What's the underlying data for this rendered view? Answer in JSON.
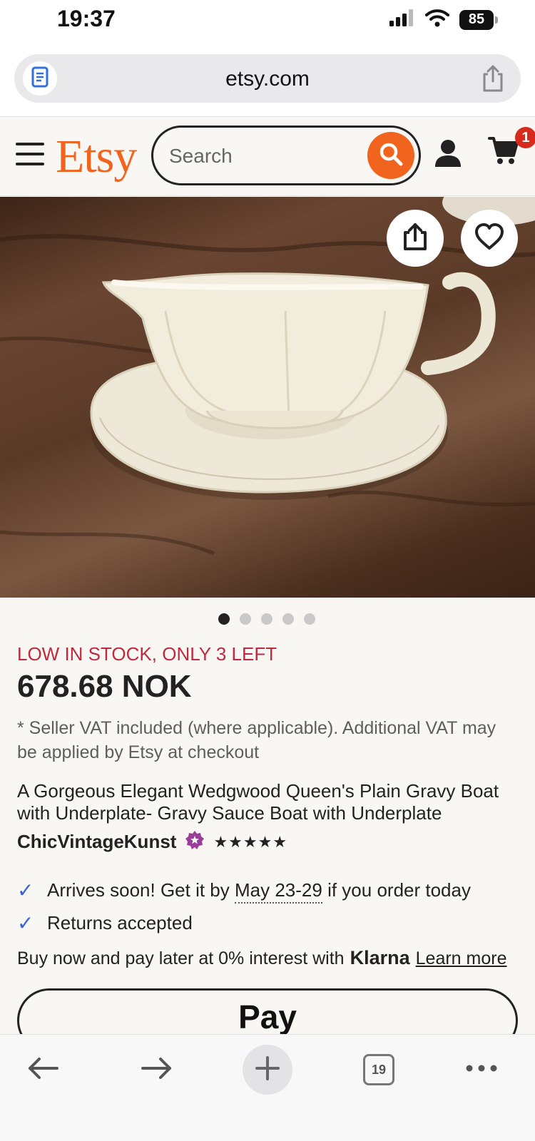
{
  "status_bar": {
    "time": "19:37",
    "battery": "85",
    "icons": [
      "signal-icon",
      "wifi-icon",
      "battery-icon"
    ]
  },
  "browser": {
    "url": "etsy.com",
    "icons": [
      "reader-mode-icon",
      "share-icon"
    ]
  },
  "header": {
    "logo": "Etsy",
    "search_placeholder": "Search",
    "cart_count": "1",
    "brand_color": "#f1641e",
    "icons": [
      "hamburger-menu-icon",
      "search-icon",
      "user-icon",
      "cart-icon"
    ]
  },
  "product_image": {
    "icons": [
      "share-icon",
      "heart-icon"
    ],
    "carousel": {
      "total": 5,
      "active_index": 0
    }
  },
  "product": {
    "stock_notice": "LOW IN STOCK, ONLY 3 LEFT",
    "price": "678.68 NOK",
    "vat_note": "* Seller VAT included (where applicable). Additional VAT may be applied by Etsy at checkout",
    "title": "A Gorgeous Elegant Wedgwood Queen's Plain Gravy Boat with Underplate- Gravy Sauce Boat with Underplate",
    "seller": "ChicVintageKunst",
    "stars": "★★★★★",
    "rating": 5,
    "arrival_prefix": "Arrives soon! Get it by",
    "arrival_dates": "May 23-29",
    "arrival_suffix": "if you order today",
    "returns": "Returns accepted",
    "klarna_text": "Buy now and pay later at 0% interest with",
    "klarna_brand": "Klarna",
    "learn_more": "Learn more",
    "pay_button_label": " Pay",
    "accent_colors": {
      "stock": "#c12a3e",
      "check": "#3b63d6",
      "star_badge": "#9b3d9b"
    }
  },
  "toolbar": {
    "tabs_count": "19",
    "icons": [
      "back-arrow-icon",
      "forward-arrow-icon",
      "plus-icon",
      "tabs-icon",
      "more-icon"
    ]
  }
}
